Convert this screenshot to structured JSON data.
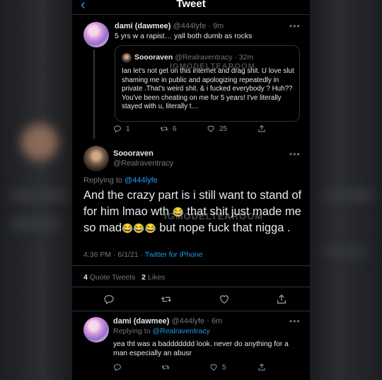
{
  "header": {
    "title": "Tweet",
    "back_glyph": "‹"
  },
  "reply1": {
    "display_name": "dami (dawmee)",
    "handle_time": "@444lyfe · 9m",
    "text": "5 yrs w a rapist… yall both dumb as rocks",
    "quote": {
      "display_name": "Soooraven",
      "handle_time": "@Realraventracy · 32m",
      "text": "Ian let's not get on this internet and drag shit. U love slut shaming me in public and apologizing repeatedly in private .That's weird shit. & i fucked everybody ? Huh?? You've been cheating on me for 5 years! I've literally stayed with u, literally t…"
    },
    "counts": {
      "replies": "1",
      "retweets": "6",
      "likes": "25"
    }
  },
  "main": {
    "display_name": "Soooraven",
    "handle": "@Realraventracy",
    "replying_prefix": "Replying to",
    "replying_to": "@444lyfe",
    "text_line1": "And the crazy part is i still want to stand of",
    "text_line2a": "for him lmao wth",
    "text_line2b": "that shit just made me",
    "text_line3a": "so mad",
    "text_line3b": "but nope fuck that nigga .",
    "emoji": "😂",
    "meta_time": "4:36 PM · 6/1/21 ·",
    "meta_client": "Twitter for iPhone",
    "quote_count": "4",
    "quote_label": "Quote Tweets",
    "like_count": "2",
    "like_label": "Likes"
  },
  "reply2": {
    "display_name": "dami (dawmee)",
    "handle_time": "@444lyfe · 6m",
    "replying_prefix": "Replying to",
    "replying_to": "@Realraventracy",
    "text": "yea tht was a baddddddd look. never do anything for a man especially an abusr",
    "counts": {
      "likes": "5"
    }
  },
  "watermark": "IGMODELTEAROOM",
  "more_glyph": "•••",
  "colors": {
    "accent": "#1d9bf0",
    "background": "#000000",
    "muted": "#71767b"
  },
  "icons": [
    "back-arrow-icon",
    "reply-icon",
    "retweet-icon",
    "like-icon",
    "share-icon",
    "more-icon"
  ]
}
